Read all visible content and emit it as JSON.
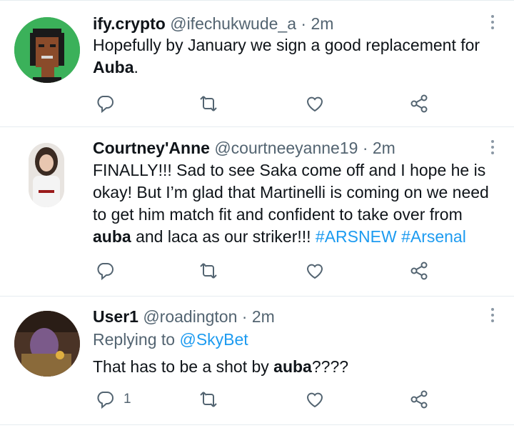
{
  "tweets": [
    {
      "display_name": "ify.crypto",
      "handle": "@ifechukwude_a",
      "separator": "·",
      "time": "2m",
      "text_before": "Hopefully by January we sign a good replacement for ",
      "text_bold": "Auba",
      "text_after": ".",
      "reply_count": ""
    },
    {
      "display_name": "Courtney'Anne",
      "handle": "@courtneeyanne19",
      "separator": "·",
      "time": "2m",
      "text_before": "FINALLY!!! Sad to see Saka come off and I hope he is okay! But I’m glad that Martinelli is coming on we need to get him match fit and confident to take over from ",
      "text_bold": "auba",
      "text_after": " and laca as our striker!!! ",
      "hashtag1": "#ARSNEW",
      "hashtag2": "#Arsenal",
      "reply_count": ""
    },
    {
      "display_name": "User1",
      "handle": "@roadington",
      "separator": "·",
      "time": "2m",
      "replying_label": "Replying to ",
      "replying_to": "@SkyBet",
      "text_before": "That has to be a shot by ",
      "text_bold": "auba",
      "text_after": "????",
      "reply_count": "1"
    }
  ],
  "icons": {
    "reply": "reply-icon",
    "retweet": "retweet-icon",
    "like": "heart-icon",
    "share": "share-icon",
    "more": "more-options-icon"
  },
  "colors": {
    "link": "#1d9bf0",
    "secondary_text": "#536471",
    "divider": "#e6ecf0"
  }
}
